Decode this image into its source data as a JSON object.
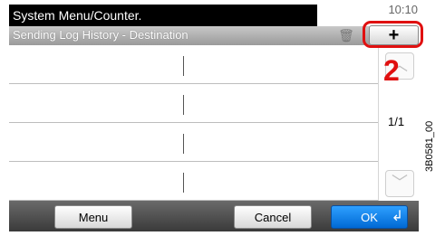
{
  "header": {
    "title": "System Menu/Counter.",
    "subtitle": "Sending Log History - Destination",
    "clock": "10:10"
  },
  "toolbar": {
    "add_label": "+",
    "delete_icon": "trash-icon"
  },
  "annotation": {
    "step_number": "2"
  },
  "list": {
    "rows": [
      {
        "left": "",
        "right": ""
      },
      {
        "left": "",
        "right": ""
      },
      {
        "left": "",
        "right": ""
      },
      {
        "left": "",
        "right": ""
      }
    ]
  },
  "pagination": {
    "page_indicator": "1/1",
    "up_icon": "chevron-up-icon",
    "down_icon": "chevron-down-icon"
  },
  "bottom": {
    "menu_label": "Menu",
    "cancel_label": "Cancel",
    "ok_label": "OK"
  },
  "figure_id": "3B0581_00",
  "colors": {
    "highlight": "#e01010",
    "ok_blue": "#0069d4",
    "title_bar": "#000000"
  }
}
